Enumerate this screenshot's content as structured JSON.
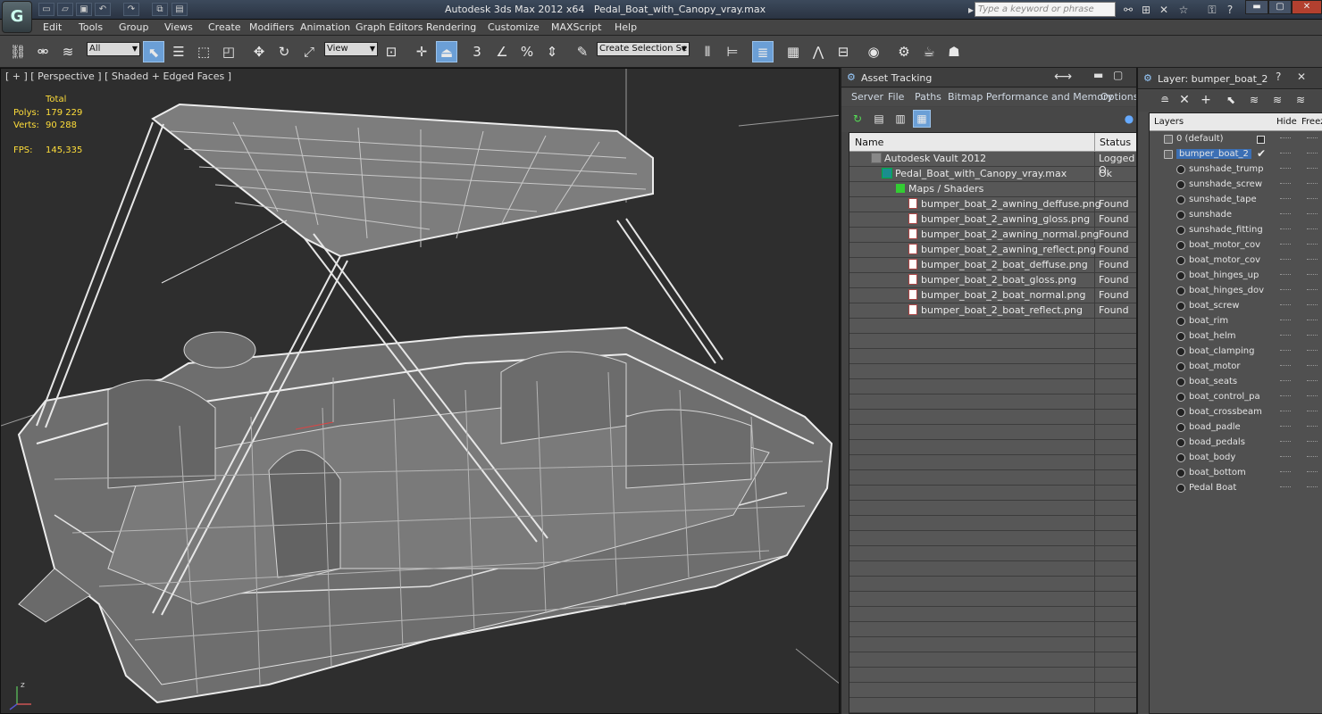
{
  "app": {
    "logo_text": "G",
    "title": "Autodesk 3ds Max  2012 x64",
    "filename": "Pedal_Boat_with_Canopy_vray.max",
    "search_placeholder": "Type a keyword or phrase"
  },
  "menu": [
    "Edit",
    "Tools",
    "Group",
    "Views",
    "Create",
    "Modifiers",
    "Animation",
    "Graph Editors",
    "Rendering",
    "Customize",
    "MAXScript",
    "Help"
  ],
  "toolbar": {
    "selection_filter": "All",
    "reference_coord": "View",
    "named_selection": "Create Selection Se",
    "snap_angle": "3",
    "percent_snap": "%"
  },
  "viewport": {
    "label": "[ + ] [ Perspective ] [ Shaded + Edged Faces ]",
    "stats": {
      "total_label": "Total",
      "polys_label": "Polys:",
      "polys_value": "179 229",
      "verts_label": "Verts:",
      "verts_value": "90 288",
      "fps_label": "FPS:",
      "fps_value": "145,335"
    },
    "axis_z": "z",
    "axis_x": "x"
  },
  "asset_tracking": {
    "title": "Asset Tracking",
    "menu": [
      "Server",
      "File",
      "Paths",
      "Bitmap Performance and Memory",
      "Options"
    ],
    "columns": {
      "name": "Name",
      "status": "Status"
    },
    "rows": [
      {
        "name": "Autodesk Vault 2012",
        "status": "Logged O",
        "indent": 24,
        "icon": "vault"
      },
      {
        "name": "Pedal_Boat_with_Canopy_vray.max",
        "status": "Ok",
        "indent": 36,
        "icon": "max"
      },
      {
        "name": "Maps / Shaders",
        "status": "",
        "indent": 52,
        "icon": "folder"
      },
      {
        "name": "bumper_boat_2_awning_deffuse.png",
        "status": "Found",
        "indent": 66,
        "icon": "file"
      },
      {
        "name": "bumper_boat_2_awning_gloss.png",
        "status": "Found",
        "indent": 66,
        "icon": "file"
      },
      {
        "name": "bumper_boat_2_awning_normal.png",
        "status": "Found",
        "indent": 66,
        "icon": "file"
      },
      {
        "name": "bumper_boat_2_awning_reflect.png",
        "status": "Found",
        "indent": 66,
        "icon": "file"
      },
      {
        "name": "bumper_boat_2_boat_deffuse.png",
        "status": "Found",
        "indent": 66,
        "icon": "file"
      },
      {
        "name": "bumper_boat_2_boat_gloss.png",
        "status": "Found",
        "indent": 66,
        "icon": "file"
      },
      {
        "name": "bumper_boat_2_boat_normal.png",
        "status": "Found",
        "indent": 66,
        "icon": "file"
      },
      {
        "name": "bumper_boat_2_boat_reflect.png",
        "status": "Found",
        "indent": 66,
        "icon": "file"
      }
    ]
  },
  "layers": {
    "title": "Layer: bumper_boat_2",
    "columns": {
      "layers": "Layers",
      "hide": "Hide",
      "freeze": "Freeze"
    },
    "items": [
      {
        "name": "0 (default)",
        "level": 0
      },
      {
        "name": "bumper_boat_2",
        "level": 0,
        "selected": true,
        "active": true
      },
      {
        "name": "sunshade_trump",
        "level": 1
      },
      {
        "name": "sunshade_screw",
        "level": 1
      },
      {
        "name": "sunshade_tape",
        "level": 1
      },
      {
        "name": "sunshade",
        "level": 1
      },
      {
        "name": "sunshade_fitting",
        "level": 1
      },
      {
        "name": "boat_motor_cov",
        "level": 1
      },
      {
        "name": "boat_motor_cov",
        "level": 1
      },
      {
        "name": "boat_hinges_up",
        "level": 1
      },
      {
        "name": "boat_hinges_dov",
        "level": 1
      },
      {
        "name": "boat_screw",
        "level": 1
      },
      {
        "name": "boat_rim",
        "level": 1
      },
      {
        "name": "boat_helm",
        "level": 1
      },
      {
        "name": "boat_clamping",
        "level": 1
      },
      {
        "name": "boat_motor",
        "level": 1
      },
      {
        "name": "boat_seats",
        "level": 1
      },
      {
        "name": "boat_control_pa",
        "level": 1
      },
      {
        "name": "boat_crossbeam",
        "level": 1
      },
      {
        "name": "boad_padle",
        "level": 1
      },
      {
        "name": "boad_pedals",
        "level": 1
      },
      {
        "name": "boat_body",
        "level": 1
      },
      {
        "name": "boat_bottom",
        "level": 1
      },
      {
        "name": "Pedal Boat",
        "level": 1
      }
    ]
  }
}
